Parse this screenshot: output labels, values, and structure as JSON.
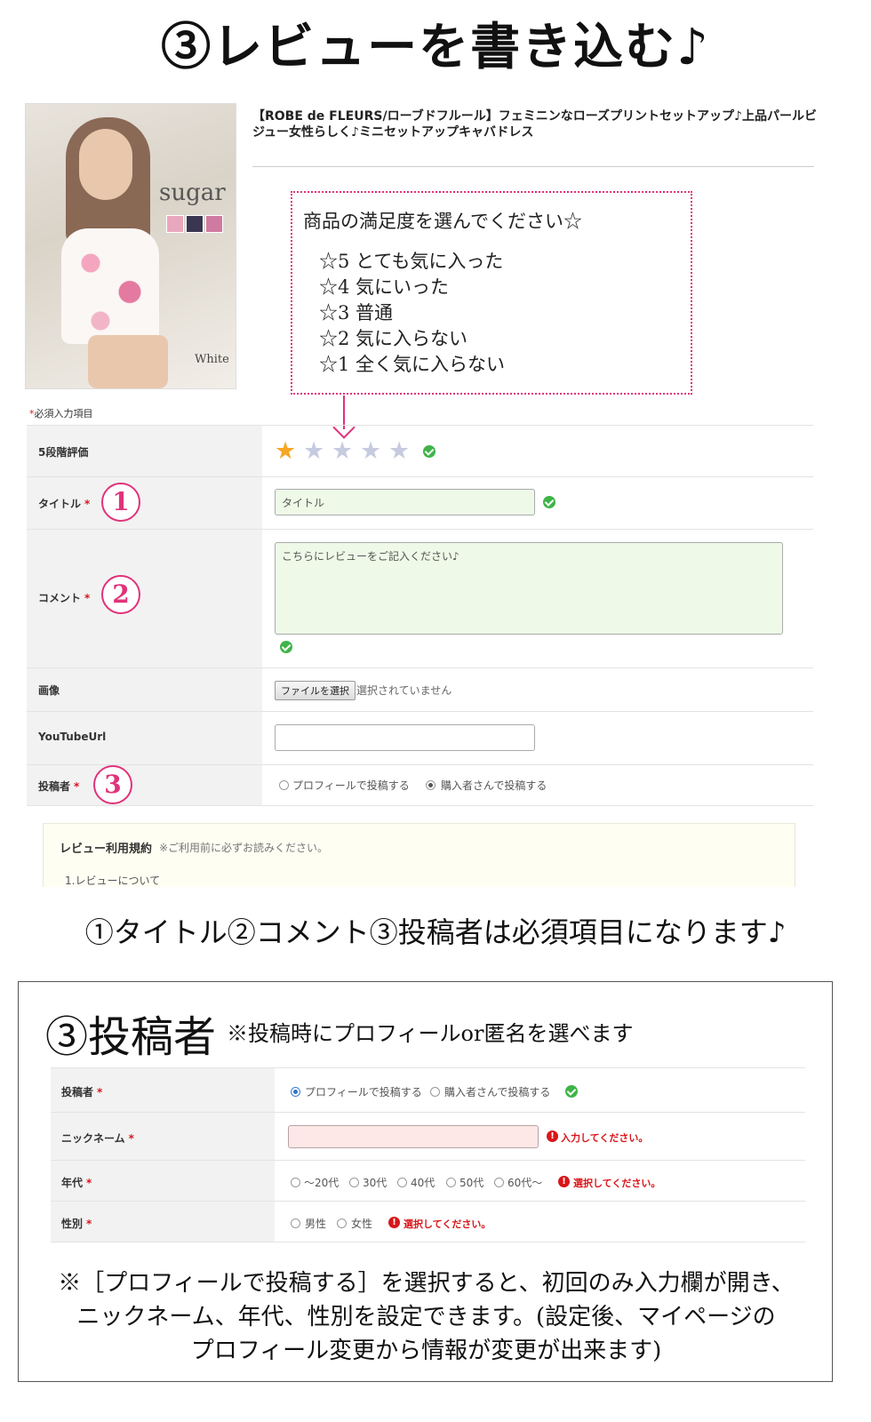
{
  "page_title": "③レビューを書き込む♪",
  "product": {
    "brand": "sugar",
    "color_label": "White",
    "name": "【ROBE de FLEURS/ローブドフルール】フェミニンなローズプリントセットアップ♪上品パールビジュー女性らしく♪ミニセットアップキャバドレス"
  },
  "rating_guide": {
    "heading": "商品の満足度を選んでください☆",
    "lines": [
      "☆5 とても気に入った",
      "☆4 気にいった",
      "☆3 普通",
      "☆2 気に入らない",
      "☆1 全く気に入らない"
    ]
  },
  "form": {
    "required_note": "必須入力項目",
    "required_mark": "*",
    "rating": {
      "label": "5段階評価",
      "value": 1,
      "max": 5
    },
    "title": {
      "label": "タイトル",
      "badge": "1",
      "placeholder": "タイトル"
    },
    "comment": {
      "label": "コメント",
      "badge": "2",
      "placeholder": "こちらにレビューをご記入ください♪"
    },
    "image": {
      "label": "画像",
      "button": "ファイルを選択",
      "status": "選択されていません"
    },
    "youtube": {
      "label": "YouTubeUrl",
      "value": ""
    },
    "poster": {
      "label": "投稿者",
      "badge": "3",
      "option_profile": "プロフィールで投稿する",
      "option_buyer": "購入者さんで投稿する",
      "selected": "option_buyer"
    }
  },
  "terms": {
    "title": "レビュー利用規約",
    "note": "※ご利用前に必ずお読みください。",
    "first_item": "1.レビューについて"
  },
  "required_caption": "①タイトル②コメント③投稿者は必須項目になります♪",
  "poster_section": {
    "heading": "③投稿者",
    "subheading": "※投稿時にプロフィールor匿名を選べます",
    "rows": {
      "poster": {
        "label": "投稿者",
        "option_profile": "プロフィールで投稿する",
        "option_buyer": "購入者さんで投稿する",
        "selected": "option_profile"
      },
      "nickname": {
        "label": "ニックネーム",
        "error": "入力してください。"
      },
      "age": {
        "label": "年代",
        "options": [
          "～20代",
          "30代",
          "40代",
          "50代",
          "60代～"
        ],
        "error": "選択してください。"
      },
      "gender": {
        "label": "性別",
        "options": [
          "男性",
          "女性"
        ],
        "error": "選択してください。"
      }
    },
    "note_lines": [
      "※［プロフィールで投稿する］を選択すると、初回のみ入力欄が開き、",
      "ニックネーム、年代、性別を設定できます。(設定後、マイページの",
      "プロフィール変更から情報が変更が出来ます)"
    ]
  },
  "colors": {
    "accent_pink": "#e0337a",
    "required_red": "#d9161c",
    "ok_green": "#3fb449",
    "star_on": "#f6a623"
  }
}
